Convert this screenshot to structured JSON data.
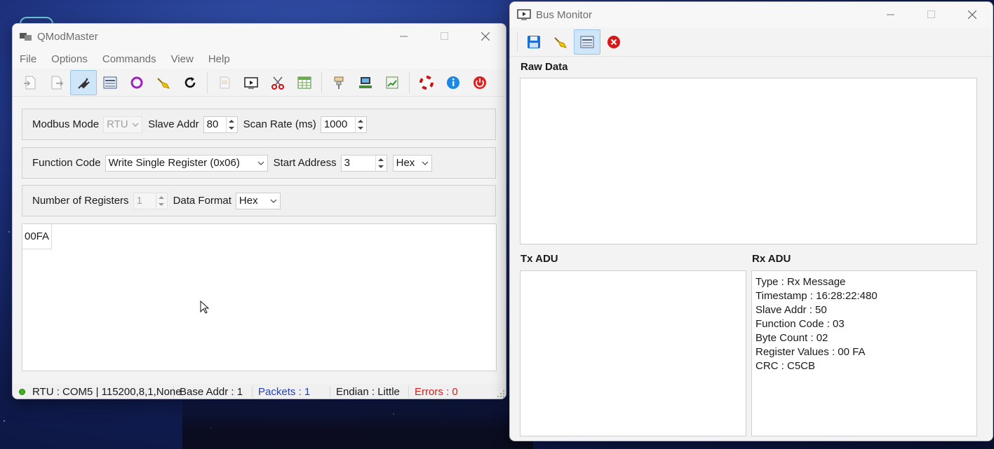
{
  "qmodmaster": {
    "title": "QModMaster",
    "menu": [
      "File",
      "Options",
      "Commands",
      "View",
      "Help"
    ],
    "toolbar_icons": [
      "load-session-icon",
      "save-session-icon",
      "connect-icon",
      "bus-monitor-icon",
      "reset-counters-icon",
      "clear-icon",
      "refresh-icon",
      "read-write-icon",
      "scan-icon",
      "cut-icon",
      "table-icon",
      "debug-icon",
      "serial-settings-icon",
      "chart-icon",
      "help-icon",
      "info-icon",
      "exit-icon"
    ],
    "mode_group": {
      "modbus_mode_label": "Modbus Mode",
      "modbus_mode_value": "RTU",
      "slave_addr_label": "Slave Addr",
      "slave_addr_value": "80",
      "scan_rate_label": "Scan Rate (ms)",
      "scan_rate_value": "1000"
    },
    "function_group": {
      "function_code_label": "Function Code",
      "function_code_value": "Write Single Register (0x06)",
      "start_address_label": "Start Address",
      "start_address_value": "3",
      "address_format_value": "Hex"
    },
    "registers_group": {
      "num_registers_label": "Number of Registers",
      "num_registers_value": "1",
      "data_format_label": "Data Format",
      "data_format_value": "Hex"
    },
    "values": [
      "00FA"
    ],
    "status": {
      "connection": "RTU : COM5 | 115200,8,1,None",
      "base_addr": "Base Addr : 1",
      "packets": "Packets : 1",
      "endian": "Endian : Little",
      "errors": "Errors : 0"
    }
  },
  "bus_monitor": {
    "title": "Bus Monitor",
    "raw_data_label": "Raw Data",
    "tx_label": "Tx ADU",
    "rx_label": "Rx ADU",
    "rx_lines": [
      "Type : Rx Message",
      "Timestamp : 16:28:22:480",
      "Slave Addr : 50",
      "Function Code : 03",
      "Byte Count : 02",
      "Register Values : 00 FA",
      "CRC : C5CB"
    ]
  },
  "colors": {
    "status_led": "#3fb21a",
    "packets_text": "#1f3fcf",
    "errors_text": "#d02020",
    "active_toolbar": "#cfe5f8"
  }
}
